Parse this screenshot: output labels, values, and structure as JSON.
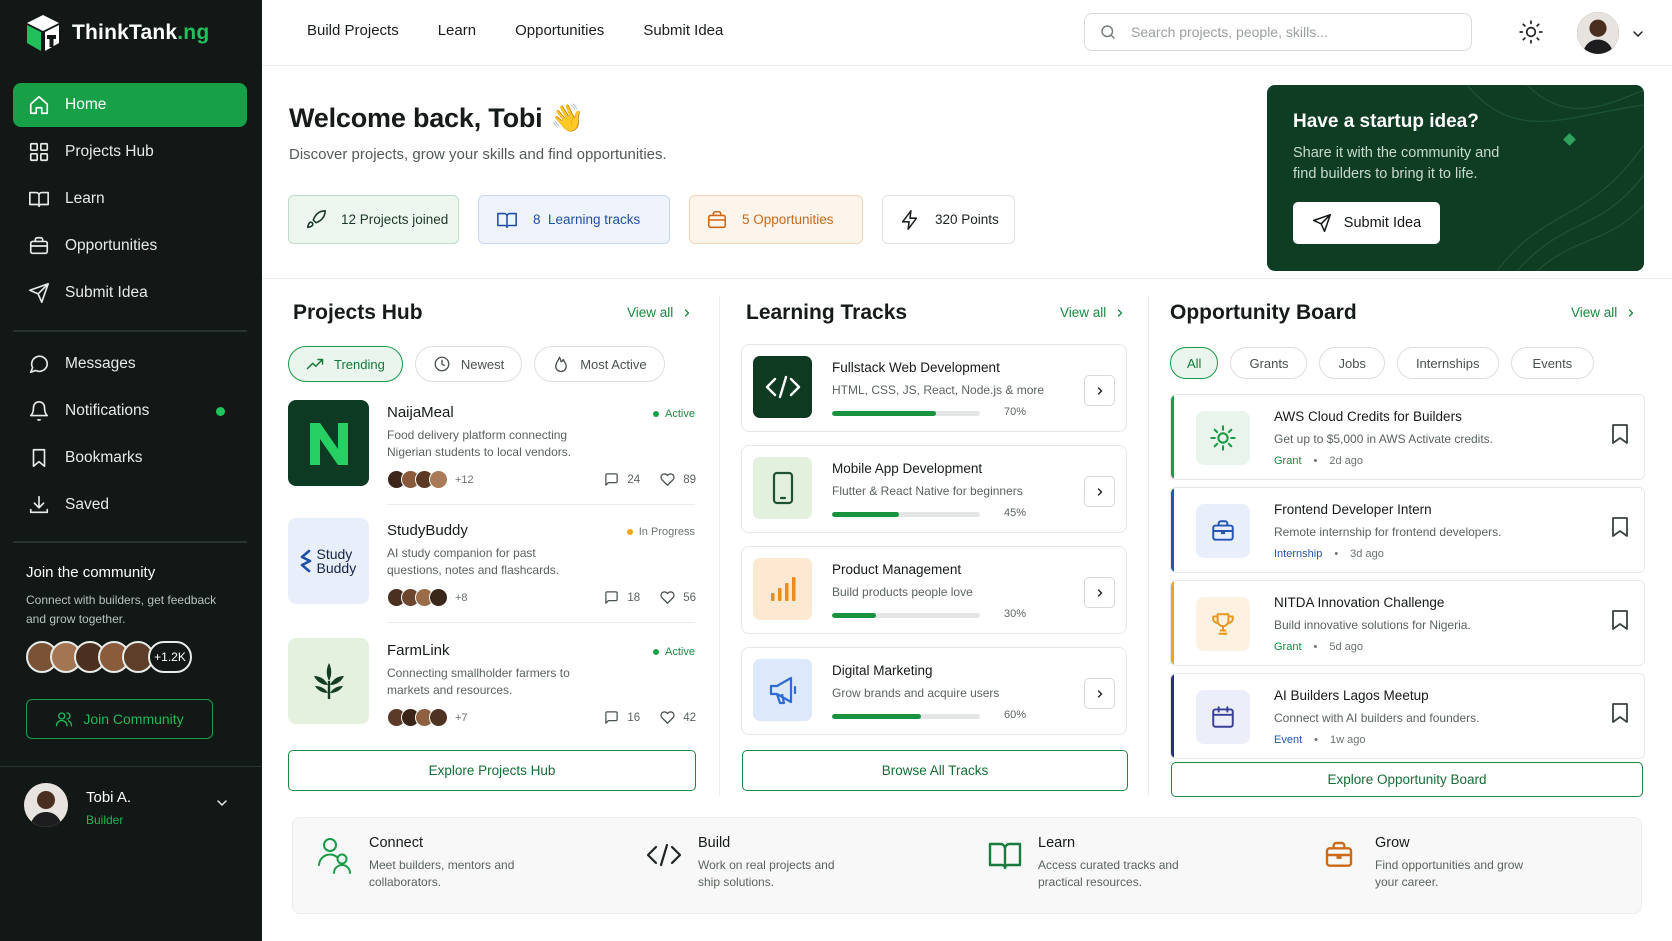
{
  "brand": {
    "name": "ThinkTank",
    "suffix": ".ng"
  },
  "colors": {
    "primary": "#18a048",
    "sidebar_bg": "#121816",
    "startup_bg": "#0f3d24",
    "warning": "#f0a417",
    "accent_blue": "#1f4fa8",
    "accent_orange": "#cb6a18"
  },
  "sidebar": {
    "nav": [
      {
        "label": "Home",
        "icon": "home-icon",
        "active": true
      },
      {
        "label": "Projects Hub",
        "icon": "grid-icon"
      },
      {
        "label": "Learn",
        "icon": "book-icon"
      },
      {
        "label": "Opportunities",
        "icon": "briefcase-icon"
      },
      {
        "label": "Submit Idea",
        "icon": "send-icon"
      }
    ],
    "secondary": [
      {
        "label": "Messages",
        "icon": "message-icon"
      },
      {
        "label": "Notifications",
        "icon": "bell-icon"
      },
      {
        "label": "Bookmarks",
        "icon": "bookmark-icon"
      },
      {
        "label": "Saved",
        "icon": "download-icon"
      }
    ],
    "community": {
      "title": "Join the community",
      "text": "Connect with builders, get feedback and grow together.",
      "count": "+1.2K",
      "button": "Join Community"
    },
    "user": {
      "name": "Tobi A.",
      "role": "Builder"
    }
  },
  "topbar": {
    "links": [
      "Build Projects",
      "Learn",
      "Opportunities",
      "Submit Idea"
    ],
    "search_placeholder": "Search projects, people, skills..."
  },
  "welcome": {
    "title": "Welcome back, Tobi",
    "emoji": "👋",
    "subtitle": "Discover projects, grow your skills and find opportunities.",
    "stats": [
      "12 Projects joined",
      "8  Learning tracks",
      "5 Opportunities",
      "320 Points"
    ]
  },
  "startup": {
    "title": "Have a startup idea?",
    "text": "Share it with the community and find builders to bring it to life.",
    "button": "Submit Idea"
  },
  "projects_hub": {
    "title": "Projects Hub",
    "view_all": "View all",
    "filters": [
      "Trending",
      "Newest",
      "Most Active"
    ],
    "items": [
      {
        "name": "NaijaMeal",
        "desc": "Food delivery platform connecting Nigerian students to local vendors.",
        "status": "Active",
        "more": "+12",
        "comments": "24",
        "likes": "89"
      },
      {
        "name": "StudyBuddy",
        "logo_text": "Study Buddy",
        "desc": "AI study companion for past questions, notes and flashcards.",
        "status": "In Progress",
        "more": "+8",
        "comments": "18",
        "likes": "56"
      },
      {
        "name": "FarmLink",
        "desc": "Connecting smallholder farmers to markets and resources.",
        "status": "Active",
        "more": "+7",
        "comments": "16",
        "likes": "42"
      }
    ],
    "button": "Explore Projects Hub"
  },
  "learning": {
    "title": "Learning Tracks",
    "view_all": "View all",
    "items": [
      {
        "name": "Fullstack Web Development",
        "desc": "HTML, CSS, JS, React, Node.js & more",
        "progress": "70%",
        "value": 70
      },
      {
        "name": "Mobile App Development",
        "desc": "Flutter & React Native for beginners",
        "progress": "45%",
        "value": 45
      },
      {
        "name": "Product Management",
        "desc": "Build products people love",
        "progress": "30%",
        "value": 30
      },
      {
        "name": "Digital Marketing",
        "desc": "Grow brands and acquire users",
        "progress": "60%",
        "value": 60
      }
    ],
    "button": "Browse All Tracks"
  },
  "opportunities": {
    "title": "Opportunity Board",
    "view_all": "View all",
    "filters": [
      "All",
      "Grants",
      "Jobs",
      "Internships",
      "Events"
    ],
    "items": [
      {
        "name": "AWS Cloud Credits for Builders",
        "desc": "Get up to $5,000 in AWS Activate credits.",
        "type": "Grant",
        "time": "2d ago"
      },
      {
        "name": "Frontend Developer Intern",
        "desc": "Remote internship for frontend developers.",
        "type": "Internship",
        "time": "3d ago"
      },
      {
        "name": "NITDA Innovation Challenge",
        "desc": "Build innovative solutions for Nigeria.",
        "type": "Grant",
        "time": "5d ago"
      },
      {
        "name": "AI Builders Lagos Meetup",
        "desc": "Connect with AI builders and founders.",
        "type": "Event",
        "time": "1w ago"
      }
    ],
    "button": "Explore Opportunity Board"
  },
  "features": [
    {
      "title": "Connect",
      "desc": "Meet builders, mentors and collaborators."
    },
    {
      "title": "Build",
      "desc": "Work on real projects and ship solutions."
    },
    {
      "title": "Learn",
      "desc": "Access curated tracks and practical resources."
    },
    {
      "title": "Grow",
      "desc": "Find opportunities and grow your career."
    }
  ]
}
